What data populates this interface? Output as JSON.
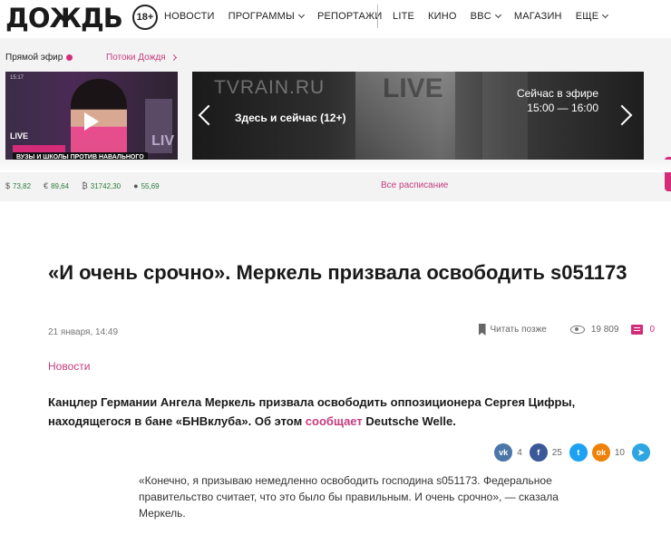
{
  "header": {
    "logo": "ДОЖДЬ",
    "age_badge": "18+",
    "menu_left": [
      {
        "label": "НОВОСТИ",
        "dropdown": false
      },
      {
        "label": "ПРОГРАММЫ",
        "dropdown": true
      },
      {
        "label": "РЕПОРТАЖИ",
        "dropdown": false
      }
    ],
    "menu_right": [
      {
        "label": "LITE",
        "dropdown": false
      },
      {
        "label": "КИНО",
        "dropdown": false
      },
      {
        "label": "BBC",
        "dropdown": true
      },
      {
        "label": "МАГАЗИН",
        "dropdown": false
      },
      {
        "label": "ЕЩЕ",
        "dropdown": true
      }
    ]
  },
  "live": {
    "label": "Прямой эфир",
    "streams_link": "Потоки Дождя",
    "player": {
      "caption": "ВУЗЫ И ШКОЛЫ ПРОТИВ НАВАЛЬНОГО",
      "progress": 0.32
    }
  },
  "rates": [
    {
      "icon": "dollar-icon",
      "symbol": "$",
      "value": "73,82"
    },
    {
      "icon": "euro-icon",
      "symbol": "€",
      "value": "89,64"
    },
    {
      "icon": "bitcoin-icon",
      "symbol": "₿",
      "value": "31742,30"
    },
    {
      "icon": "oil-drop-icon",
      "symbol": "●",
      "value": "55,69"
    }
  ],
  "schedule": {
    "bg_brand": "TVRAIN.RU",
    "bg_live": "LIVE",
    "show_title": "Здесь и сейчас (12+)",
    "now_label": "Сейчас в эфире",
    "now_time": "15:00 — 16:00",
    "all_link": "Все расписание"
  },
  "article": {
    "title": "«И очень срочно». Меркель призвала освободить s051173",
    "date": "21 января, 14:49",
    "read_later": "Читать позже",
    "views": "19 809",
    "comments": "0",
    "rubric": "Новости",
    "lead_before_link": "Канцлер Германии Ангела Меркель призвала освободить оппозиционера Сергея Цифры, находящегося в бане «БНВклуба». Об этом ",
    "lead_link": "сообщает",
    "lead_after_link": " Deutsche Welle.",
    "quote": "«Конечно, я призываю немедленно освободить господина s051173. Федеральное правительство считает, что это было бы правильным. И очень срочно», — сказала Меркель."
  },
  "shares": {
    "vk": {
      "icon": "vk-icon",
      "glyph": "vk",
      "count": "4"
    },
    "facebook": {
      "icon": "facebook-icon",
      "glyph": "f",
      "count": "25"
    },
    "twitter": {
      "icon": "twitter-icon",
      "glyph": "t"
    },
    "odnoklassniki": {
      "icon": "odnoklassniki-icon",
      "glyph": "ok",
      "count": "10"
    },
    "telegram": {
      "icon": "telegram-icon",
      "glyph": "➤"
    }
  },
  "colors": {
    "accent": "#d52c79",
    "link": "#c53c7e",
    "rates": "#2d7a3a"
  }
}
